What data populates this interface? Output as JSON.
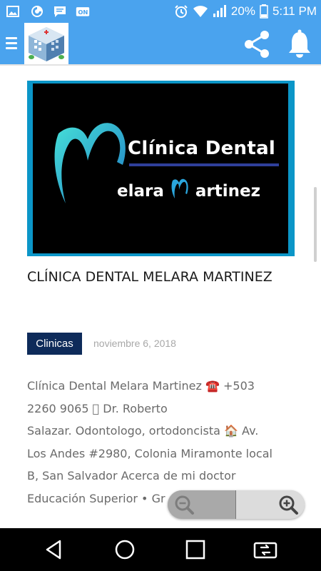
{
  "status_bar": {
    "battery_percent": "20%",
    "time": "5:11 PM",
    "left_icons": [
      "gallery-icon",
      "firefox-icon",
      "message-icon",
      "vpn-icon"
    ],
    "right_icons": [
      "alarm-icon",
      "wifi-icon",
      "signal-icon",
      "battery-icon"
    ]
  },
  "app_bar": {
    "color": "#4aa3ee",
    "icons": [
      "menu-icon",
      "hospital-logo",
      "share-icon",
      "bell-icon"
    ]
  },
  "featured_image": {
    "brand_line1": "Clínica Dental",
    "brand_line2_part1": "elara",
    "brand_line2_part2": "artinez"
  },
  "post": {
    "title": "CLÍNICA DENTAL MELARA MARTINEZ",
    "category": "Clinicas",
    "date": "noviembre 6, 2018",
    "body_lines": [
      "Clínica Dental Melara Martinez ☎️  +503",
      "2260 9065 ⃞ Dr. Roberto",
      "Salazar. Odontologo, ortodoncista 🏠 Av.",
      "Los Andes #2980, Colonia Miramonte local",
      "B, San Salvador        Acerca de mi doctor",
      "Educación Superior • Gr"
    ]
  },
  "zoom": {
    "icons": [
      "zoom-out-icon",
      "zoom-in-icon"
    ]
  },
  "nav_bar": {
    "icons": [
      "back-icon",
      "home-icon",
      "recents-icon",
      "screen-mirror-icon"
    ]
  },
  "colors": {
    "primary": "#4aa3ee",
    "badge": "#0e2b5a",
    "brand_teal": "#0b96c8"
  }
}
